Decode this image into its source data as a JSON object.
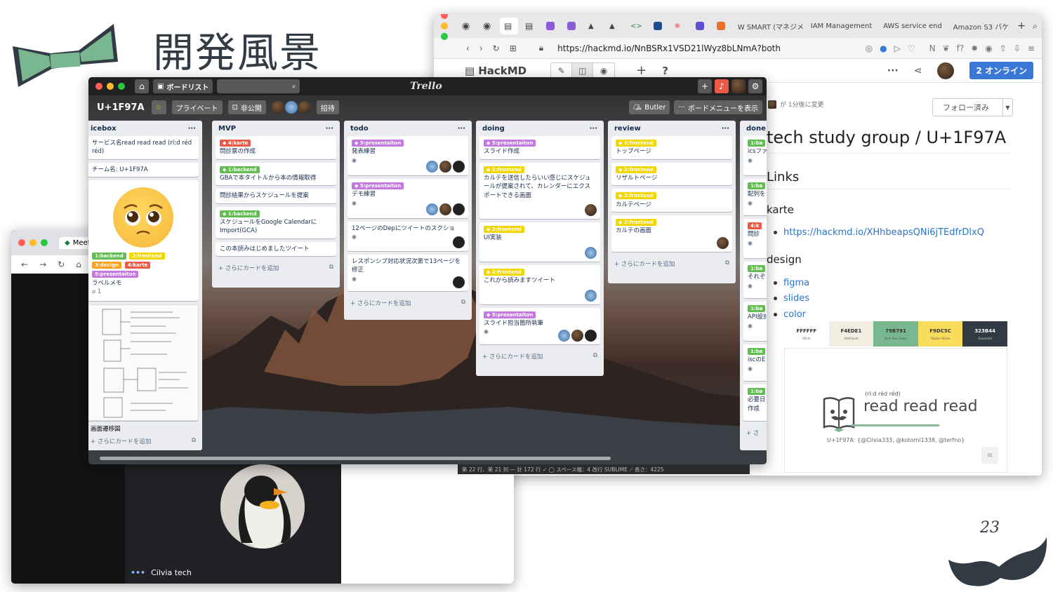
{
  "slide": {
    "title": "開発風景",
    "page_number": "23"
  },
  "hackmd": {
    "tabs": [
      "",
      "",
      "",
      "",
      "",
      "",
      "",
      "",
      "",
      "",
      "",
      "",
      "",
      "",
      "",
      "W SMART (マネジメ",
      "IAM Management",
      "AWS service end",
      "Amazon S3 バケ"
    ],
    "url": "https://hackmd.io/NnBSRx1VSD21lWyz8bLNmA?both",
    "app_name": "HackMD",
    "online_label": "2 オンライン",
    "changed": "が 1分後に変更",
    "follow_label": "フォロー済み",
    "heading": "tech study group / U+1F97A",
    "links_heading": "Links",
    "karte_heading": "karte",
    "karte_link": "https://hackmd.io/XHhbeapsQNi6jTEdfrDlxQ",
    "design_heading": "design",
    "design_links": [
      "figma",
      "slides",
      "color"
    ],
    "palette": [
      {
        "hex": "FFFFFF",
        "color": "#FFFFFF",
        "text": "#333333",
        "name": "White"
      },
      {
        "hex": "F4EDE1",
        "color": "#F4EDE1",
        "text": "#333333",
        "name": "Additional"
      },
      {
        "hex": "79B791",
        "color": "#79B791",
        "text": "#333333",
        "name": "Dark Sea Green"
      },
      {
        "hex": "F9DC5C",
        "color": "#F9DC5C",
        "text": "#333333",
        "name": "Naples Yellow"
      },
      {
        "hex": "323B44",
        "color": "#323B44",
        "text": "#FFFFFF",
        "name": "Gunmetal"
      }
    ],
    "logo_sub": "(rí:d réd réd)",
    "logo_main": "read read read",
    "logo_credit": "U+1F97A: {@Cilvia333, @kotomi1338, @terfno}"
  },
  "meet": {
    "tab_label": "Meet",
    "participant": "Cilvia tech"
  },
  "trello": {
    "top_board_list": "ボードリスト",
    "brand": "Trello",
    "board_name": "U+1F97A",
    "privacy": "プライベート",
    "visibility": "非公開",
    "invite": "招待",
    "butler": "Butler",
    "show_menu": "ボードメニューを表示",
    "add_card": "+ さらにカードを追加",
    "lists": [
      {
        "title": "icebox"
      },
      {
        "title": "MVP"
      },
      {
        "title": "todo"
      },
      {
        "title": "doing"
      },
      {
        "title": "review"
      },
      {
        "title": "done"
      }
    ],
    "icebox": {
      "card1": "サービス名read read read (ríːd réd réd)",
      "card2": "チーム名: U+1F97A",
      "labels": [
        "1:backend",
        "2:frontend",
        "3:design",
        "4:karte",
        "5:presentaiton"
      ],
      "label_memo": "ラベルメモ",
      "attach_count": "1",
      "transition": "画面遷移図"
    },
    "mvp": {
      "c1_label": "4:karte",
      "c1_text": "問診票の作成",
      "c2_label": "1:backend",
      "c2_text": "GBAで本タイトルから本の情報取得",
      "c3_text": "問診結果からスケジュールを提案",
      "c4_label": "1:backend",
      "c4_text": "スケジュールをGoogle Calendarに Import(GCA)",
      "c5_text": "この本読みはじめましたツイート"
    },
    "todo": {
      "c1_label": "5:presentaiton",
      "c1_text": "発表練習",
      "c2_label": "5:presentaiton",
      "c2_text": "デモ練習",
      "c3_text": "12ページのDepにツイートのスクショ",
      "c4_text": "レスポンシブ対応状況次第で13ページを修正"
    },
    "doing": {
      "c1_label": "5:presentaiton",
      "c1_text": "スライド作成",
      "c2_label": "2:frontend",
      "c2_text": "カルテを送信したらいい感じにスケジュールが提案されて、カレンダーにエクスポートできる画面",
      "c3_label": "2:frontend",
      "c3_text": "UI実装",
      "c4_label": "2:frontend",
      "c4_text": "これから読みますツイート",
      "c5_label": "5:presentaiton",
      "c5_text": "スライド担当箇所執筆"
    },
    "review": {
      "c1_label": "2:frontend",
      "c1_text": "トップページ",
      "c2_label": "2:frontend",
      "c2_text": "リザルトページ",
      "c3_label": "2:frontend",
      "c3_text": "カルテページ",
      "c4_label": "2:frontend",
      "c4_text": "カルテの画面"
    },
    "done": {
      "label": "1:ba",
      "label_karte": "4:k",
      "cards": [
        "icsファ",
        "配列を",
        "問診",
        "それぞ",
        "API設計",
        "iscのE",
        "必要日"
      ],
      "last_extra": "作成"
    }
  },
  "editor_status": "第 22 行、第 21 列 — 計 172 行   ✓   ◯   スペース幅：4   改行   SUBLIME   ⟋   長さ：4225"
}
